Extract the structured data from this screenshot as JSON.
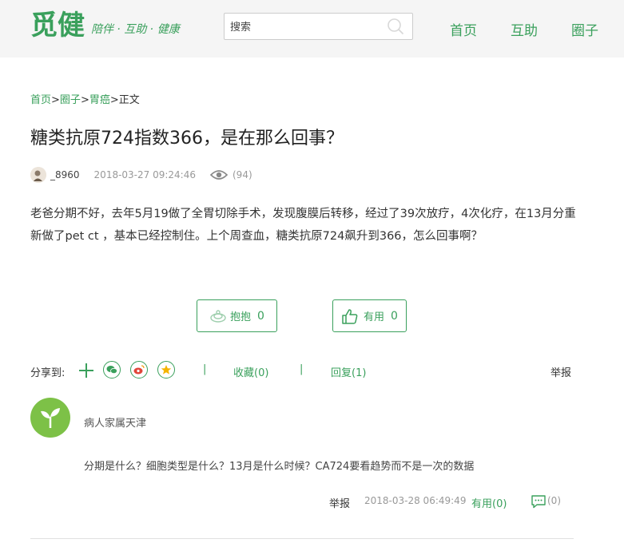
{
  "header": {
    "logo_text": "觅健",
    "slogan": "陪伴 · 互助 · 健康",
    "search_placeholder": "搜索",
    "nav": [
      "首页",
      "互助",
      "圈子"
    ]
  },
  "breadcrumb": {
    "items": [
      "首页",
      "圈子",
      "胃癌"
    ],
    "current": "正文",
    "separator": ">"
  },
  "post": {
    "title": "糖类抗原724指数366，是在那么回事？",
    "author": "_8960",
    "time": "2018-03-27 09:24:46",
    "views": "(94)",
    "body": "老爸分期不好，去年5月19做了全胃切除手术，发现腹膜后转移，经过了39次放疗，4次化疗，在13月分重新做了pet ct ，基本已经控制住。上个周查血，糖类抗原724飙升到366，怎么回事啊？"
  },
  "actions": {
    "hug_label": "抱抱",
    "hug_count": "0",
    "useful_label": "有用",
    "useful_count": "0"
  },
  "share": {
    "label": "分享到:",
    "sep": "|",
    "favorite": "收藏(0)",
    "reply": "回复(1)",
    "report": "举报"
  },
  "reply": {
    "user": "病人家属天津",
    "text": "分期是什么？细胞类型是什么？13月是什么时候？CA724要看趋势而不是一次的数据",
    "report": "举报",
    "time": "2018-03-28 06:49:49",
    "useful": "有用(0)",
    "comments": "(0)"
  },
  "colors": {
    "brand": "#3aa05c",
    "header_bg": "#f5f5f5"
  }
}
